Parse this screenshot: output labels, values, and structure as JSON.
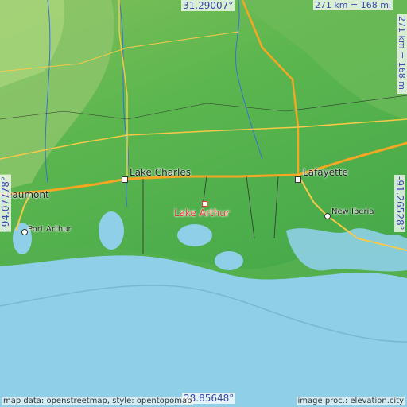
{
  "map": {
    "coords": {
      "north": "31.29007°",
      "south": "28.85648°",
      "west": "-94.07778°",
      "east": "-91.26528°"
    },
    "scale": {
      "top": "271 km = 168 mi",
      "right": "271 km = 168 mi"
    },
    "cities": [
      {
        "name": "Lake Charles"
      },
      {
        "name": "Lafayette"
      },
      {
        "name": "Beaumont",
        "visible_text": "eaumont"
      },
      {
        "name": "Port Arthur"
      },
      {
        "name": "New Iberia"
      }
    ],
    "target": {
      "name": "Lake Arthur"
    },
    "attribution": {
      "left": "map data: openstreetmap, style: opentopomap",
      "right": "image proc.: elevation.city"
    },
    "colors": {
      "land_low": "#4caf50",
      "land_high": "#a8d47a",
      "water": "#8fcfe8",
      "target": "#e53935",
      "coord_text": "#3949ab"
    }
  }
}
